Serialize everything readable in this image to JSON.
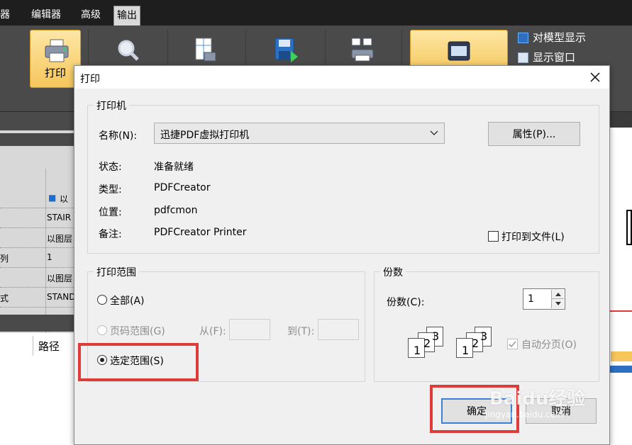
{
  "menubar": {
    "items": [
      {
        "label": "器"
      },
      {
        "label": "编辑器"
      },
      {
        "label": "高级"
      },
      {
        "label": "输出"
      }
    ]
  },
  "ribbon": {
    "print_label": "打印",
    "view_options": [
      "对模型显示",
      "显示窗口"
    ]
  },
  "left_panel": {
    "rows": [
      {
        "key": "",
        "value": "以"
      },
      {
        "key": "",
        "value": "STAIR"
      },
      {
        "key": "",
        "value": "以图层"
      },
      {
        "key": "列",
        "value": "1"
      },
      {
        "key": "",
        "value": "以图层"
      },
      {
        "key": "式",
        "value": "STAND"
      }
    ],
    "path_header": "路径"
  },
  "dialog": {
    "title": "打印",
    "printer_group": {
      "legend": "打印机",
      "name_label": "名称(N):",
      "name_value": "迅捷PDF虚拟打印机",
      "properties_button": "属性(P)...",
      "status_label": "状态:",
      "status_value": "准备就绪",
      "type_label": "类型:",
      "type_value": "PDFCreator",
      "location_label": "位置:",
      "location_value": "pdfcmon",
      "comment_label": "备注:",
      "comment_value": "PDFCreator Printer",
      "print_to_file": "打印到文件(L)"
    },
    "range_group": {
      "legend": "打印范围",
      "all": "全部(A)",
      "pages": "页码范围(G)",
      "from_label": "从(F):",
      "to_label": "到(T):",
      "selection": "选定范围(S)"
    },
    "copies_group": {
      "legend": "份数",
      "copies_label": "份数(C):",
      "copies_value": "1",
      "collate": "自动分页(O)",
      "collate_digits": [
        "1",
        "2",
        "3"
      ]
    },
    "ok_button": "确定",
    "cancel_button": "取消"
  },
  "watermark": {
    "main": "Baidu经验",
    "sub": "jingyan.baidu.com"
  },
  "colors": {
    "highlight_red": "#e03b3b",
    "ribbon_active": "#f6c65b",
    "default_button_border": "#3c7fd6"
  }
}
